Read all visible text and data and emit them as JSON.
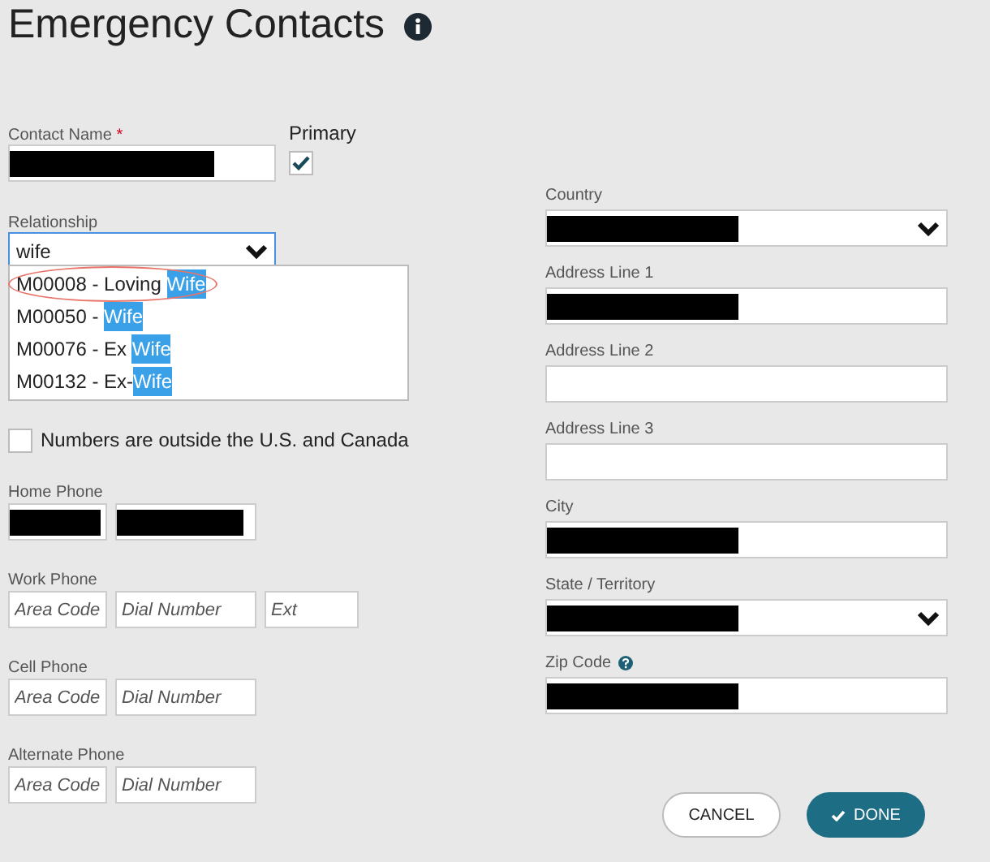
{
  "title": "Emergency Contacts",
  "contact_name": {
    "label": "Contact Name",
    "required_mark": "*",
    "redacted": true
  },
  "primary": {
    "label": "Primary",
    "checked": true
  },
  "relationship": {
    "label": "Relationship",
    "value": "wife",
    "expanded": true,
    "options": [
      {
        "prefix": "M00008 - Loving ",
        "match": "Wife",
        "circled": true
      },
      {
        "prefix": "M00050 - ",
        "match": "Wife",
        "circled": false
      },
      {
        "prefix": "M00076 - Ex ",
        "match": "Wife",
        "circled": false
      },
      {
        "prefix": "M00132 - Ex-",
        "match": "Wife",
        "circled": false
      }
    ]
  },
  "outside_us": {
    "label": "Numbers are outside the U.S. and Canada",
    "checked": false
  },
  "phones": [
    {
      "label": "Home Phone",
      "fields": [
        {
          "redacted": true,
          "kind": "area"
        },
        {
          "redacted": true,
          "kind": "number"
        }
      ]
    },
    {
      "label": "Work Phone",
      "fields": [
        {
          "placeholder": "Area Code",
          "kind": "area"
        },
        {
          "placeholder": "Dial Number",
          "kind": "number"
        },
        {
          "placeholder": "Ext",
          "kind": "ext"
        }
      ]
    },
    {
      "label": "Cell Phone",
      "fields": [
        {
          "placeholder": "Area Code",
          "kind": "area"
        },
        {
          "placeholder": "Dial Number",
          "kind": "number"
        }
      ]
    },
    {
      "label": "Alternate Phone",
      "fields": [
        {
          "placeholder": "Area Code",
          "kind": "area"
        },
        {
          "placeholder": "Dial Number",
          "kind": "number"
        }
      ]
    }
  ],
  "address": [
    {
      "label": "Country",
      "kind": "select",
      "redacted": true
    },
    {
      "label": "Address Line 1",
      "kind": "text",
      "redacted": true
    },
    {
      "label": "Address Line 2",
      "kind": "text"
    },
    {
      "label": "Address Line 3",
      "kind": "text"
    },
    {
      "label": "City",
      "kind": "text",
      "redacted": true
    },
    {
      "label": "State / Territory",
      "kind": "select",
      "redacted": true
    },
    {
      "label": "Zip Code",
      "kind": "text",
      "redacted": true,
      "help": true
    }
  ],
  "buttons": [
    {
      "label": "CANCEL",
      "kind": "secondary"
    },
    {
      "label": "DONE",
      "kind": "primary"
    }
  ]
}
